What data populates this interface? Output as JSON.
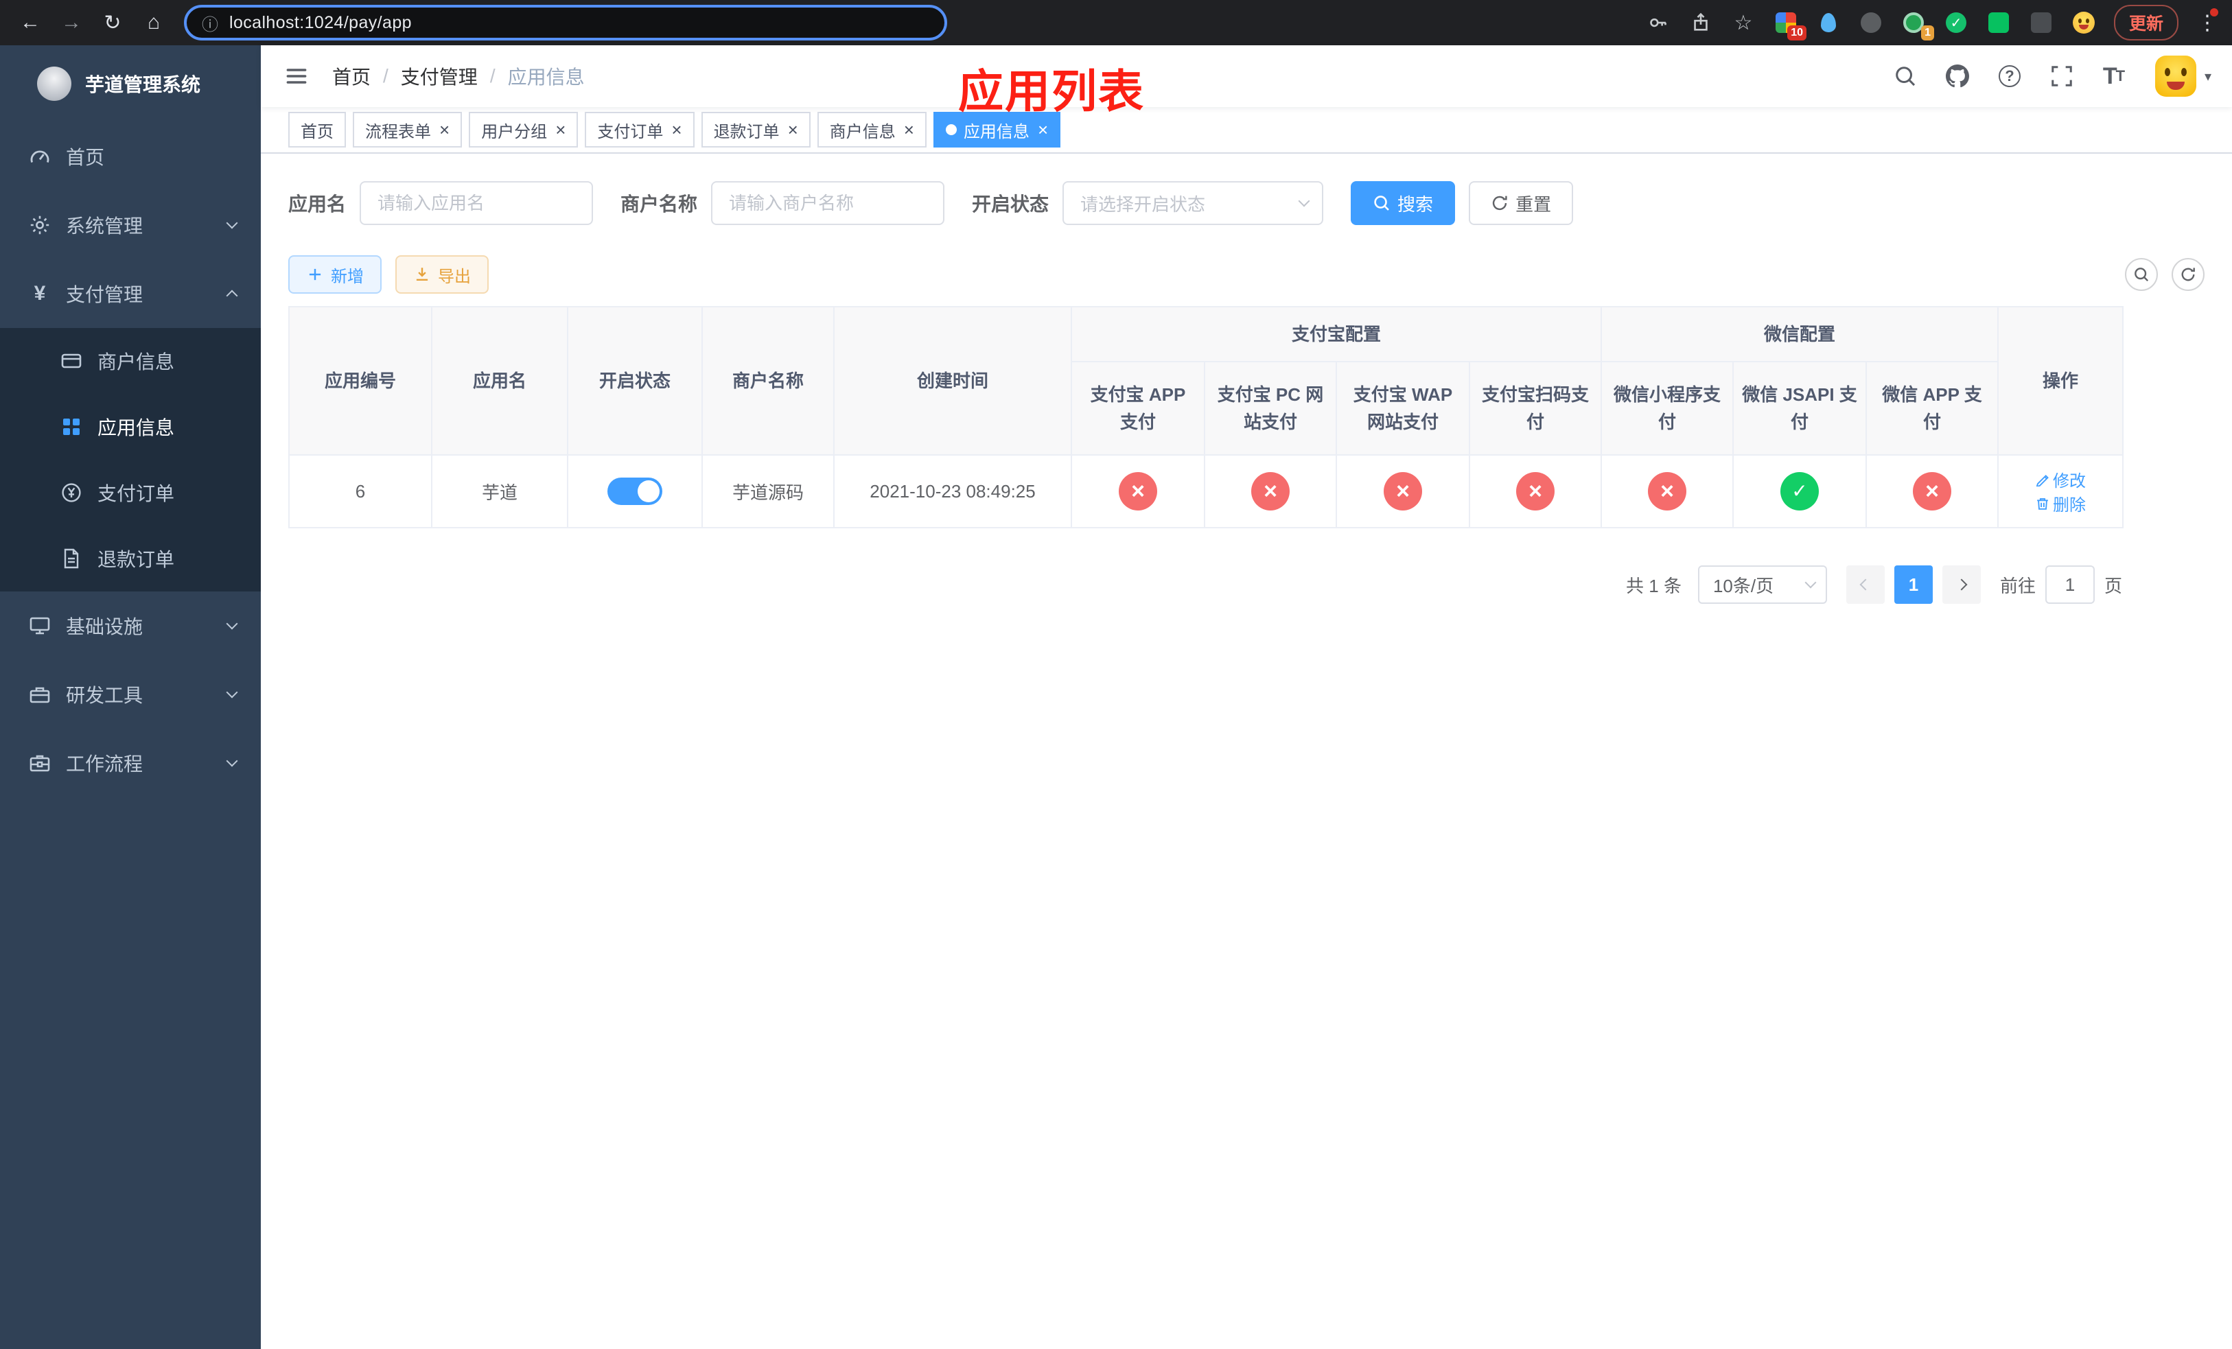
{
  "colors": {
    "primary": "#409eff",
    "success": "#13ce66",
    "danger": "#f56c6c",
    "warning": "#e6a23c",
    "sidebar_bg": "#304156",
    "submenu_bg": "#1f2d3d",
    "annotation_red": "#fc2014"
  },
  "icons": {
    "back": "←",
    "forward": "→",
    "reload": "↻",
    "home": "⌂",
    "info": "ⓘ",
    "star": "☆",
    "dots": "⋮",
    "caret_down": "▾",
    "close": "×",
    "check": "✓",
    "question": "?",
    "yen": "¥",
    "font_size": "T",
    "breadcrumb_sep": "/"
  },
  "browser": {
    "url": "localhost:1024/pay/app",
    "update_label": "更新",
    "extension_badge_1": "10",
    "extension_badge_2": "1"
  },
  "sidebar": {
    "title": "芋道管理系统",
    "items": [
      {
        "label": "首页"
      },
      {
        "label": "系统管理"
      },
      {
        "label": "支付管理",
        "expanded": true,
        "children": [
          {
            "label": "商户信息"
          },
          {
            "label": "应用信息",
            "active": true
          },
          {
            "label": "支付订单"
          },
          {
            "label": "退款订单"
          }
        ]
      },
      {
        "label": "基础设施"
      },
      {
        "label": "研发工具"
      },
      {
        "label": "工作流程"
      }
    ]
  },
  "header": {
    "breadcrumb": [
      "首页",
      "支付管理",
      "应用信息"
    ],
    "annotation": "应用列表"
  },
  "tabs": [
    {
      "label": "首页",
      "closable": false
    },
    {
      "label": "流程表单",
      "closable": true
    },
    {
      "label": "用户分组",
      "closable": true
    },
    {
      "label": "支付订单",
      "closable": true
    },
    {
      "label": "退款订单",
      "closable": true
    },
    {
      "label": "商户信息",
      "closable": true
    },
    {
      "label": "应用信息",
      "closable": true,
      "active": true
    }
  ],
  "filters": {
    "app_name_label": "应用名",
    "app_name_placeholder": "请输入应用名",
    "merchant_label": "商户名称",
    "merchant_placeholder": "请输入商户名称",
    "status_label": "开启状态",
    "status_placeholder": "请选择开启状态",
    "search_label": "搜索",
    "reset_label": "重置"
  },
  "toolbar": {
    "add_label": "新增",
    "export_label": "导出"
  },
  "table": {
    "group_headers": {
      "alipay": "支付宝配置",
      "wechat": "微信配置"
    },
    "columns": [
      "应用编号",
      "应用名",
      "开启状态",
      "商户名称",
      "创建时间",
      "支付宝 APP 支付",
      "支付宝 PC 网站支付",
      "支付宝 WAP 网站支付",
      "支付宝扫码支付",
      "微信小程序支付",
      "微信 JSAPI 支付",
      "微信 APP 支付",
      "操作"
    ],
    "rows": [
      {
        "id": "6",
        "name": "芋道",
        "enabled": true,
        "merchant": "芋道源码",
        "created": "2021-10-23 08:49:25",
        "channels": [
          "no",
          "no",
          "no",
          "no",
          "no",
          "yes",
          "no"
        ],
        "actions": [
          "修改",
          "删除"
        ]
      }
    ]
  },
  "pagination": {
    "total": "共 1 条",
    "page_size": "10条/页",
    "current_page": "1",
    "goto_label": "前往",
    "goto_value": "1",
    "page_label": "页"
  }
}
